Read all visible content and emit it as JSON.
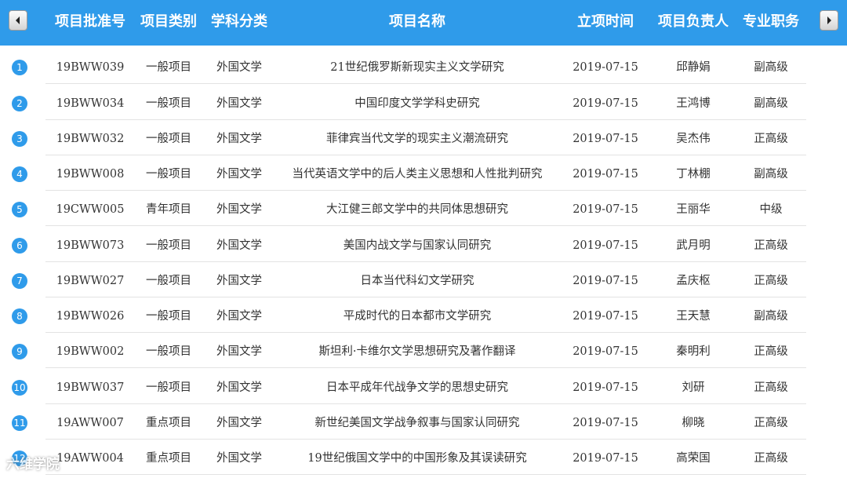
{
  "header": {
    "columns": [
      "项目批准号",
      "项目类别",
      "学科分类",
      "项目名称",
      "立项时间",
      "项目负责人",
      "专业职务"
    ]
  },
  "rows": [
    {
      "no": "1",
      "id": "19BWW039",
      "category": "一般项目",
      "discipline": "外国文学",
      "name": "21世纪俄罗斯新现实主义文学研究",
      "date": "2019-07-15",
      "leader": "邱静娟",
      "title": "副高级"
    },
    {
      "no": "2",
      "id": "19BWW034",
      "category": "一般项目",
      "discipline": "外国文学",
      "name": "中国印度文学学科史研究",
      "date": "2019-07-15",
      "leader": "王鸿博",
      "title": "副高级"
    },
    {
      "no": "3",
      "id": "19BWW032",
      "category": "一般项目",
      "discipline": "外国文学",
      "name": "菲律宾当代文学的现实主义潮流研究",
      "date": "2019-07-15",
      "leader": "吴杰伟",
      "title": "正高级"
    },
    {
      "no": "4",
      "id": "19BWW008",
      "category": "一般项目",
      "discipline": "外国文学",
      "name": "当代英语文学中的后人类主义思想和人性批判研究",
      "date": "2019-07-15",
      "leader": "丁林棚",
      "title": "副高级"
    },
    {
      "no": "5",
      "id": "19CWW005",
      "category": "青年项目",
      "discipline": "外国文学",
      "name": "大江健三郎文学中的共同体思想研究",
      "date": "2019-07-15",
      "leader": "王丽华",
      "title": "中级"
    },
    {
      "no": "6",
      "id": "19BWW073",
      "category": "一般项目",
      "discipline": "外国文学",
      "name": "美国内战文学与国家认同研究",
      "date": "2019-07-15",
      "leader": "武月明",
      "title": "正高级"
    },
    {
      "no": "7",
      "id": "19BWW027",
      "category": "一般项目",
      "discipline": "外国文学",
      "name": "日本当代科幻文学研究",
      "date": "2019-07-15",
      "leader": "孟庆枢",
      "title": "正高级"
    },
    {
      "no": "8",
      "id": "19BWW026",
      "category": "一般项目",
      "discipline": "外国文学",
      "name": "平成时代的日本都市文学研究",
      "date": "2019-07-15",
      "leader": "王天慧",
      "title": "副高级"
    },
    {
      "no": "9",
      "id": "19BWW002",
      "category": "一般项目",
      "discipline": "外国文学",
      "name": "斯坦利·卡维尔文学思想研究及著作翻译",
      "date": "2019-07-15",
      "leader": "秦明利",
      "title": "正高级"
    },
    {
      "no": "10",
      "id": "19BWW037",
      "category": "一般项目",
      "discipline": "外国文学",
      "name": "日本平成年代战争文学的思想史研究",
      "date": "2019-07-15",
      "leader": "刘研",
      "title": "正高级"
    },
    {
      "no": "11",
      "id": "19AWW007",
      "category": "重点项目",
      "discipline": "外国文学",
      "name": "新世纪美国文学战争叙事与国家认同研究",
      "date": "2019-07-15",
      "leader": "柳晓",
      "title": "正高级"
    },
    {
      "no": "12",
      "id": "19AWW004",
      "category": "重点项目",
      "discipline": "外国文学",
      "name": "19世纪俄国文学中的中国形象及其误读研究",
      "date": "2019-07-15",
      "leader": "高荣国",
      "title": "正高级"
    }
  ],
  "watermark": "六维学院",
  "colors": {
    "header_bg": "#2f9bea",
    "badge_bg": "#2f9bea",
    "row_rule": "#e3e3e3"
  },
  "icons": {
    "prev": "chevron-left-icon",
    "next": "chevron-right-icon"
  }
}
